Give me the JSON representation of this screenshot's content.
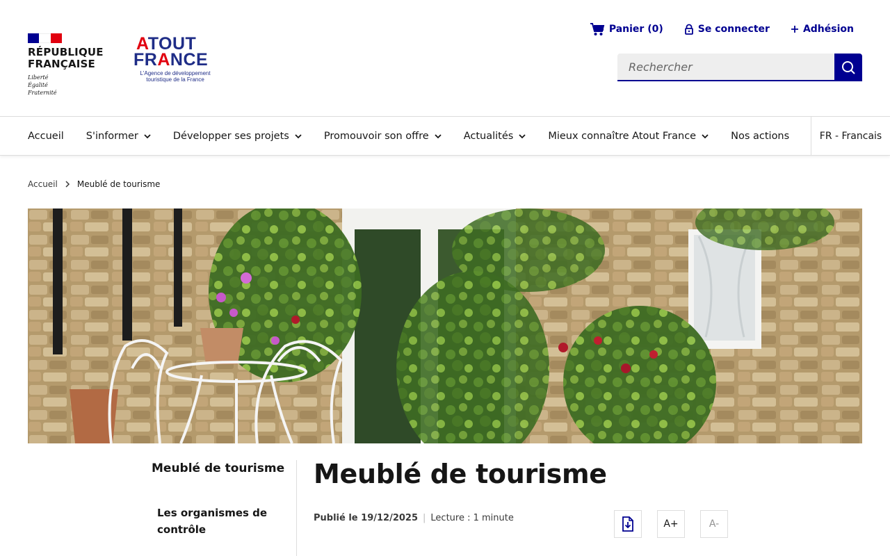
{
  "header": {
    "republique": {
      "title_line1": "RÉPUBLIQUE",
      "title_line2": "FRANÇAISE",
      "motto": [
        "Liberté",
        "Égalité",
        "Fraternité"
      ],
      "flag_colors": [
        "#000091",
        "#ffffff",
        "#e1000f"
      ]
    },
    "atout": {
      "line1_a": "A",
      "line1_rest": "TOUT",
      "line2_a": "FR",
      "line2_red": "A",
      "line2_rest": "NCE",
      "subtitle_line1": "L'Agence de développement",
      "subtitle_line2": "touristique de la France"
    },
    "tools": {
      "cart": "Panier (0)",
      "login": "Se connecter",
      "membership": "Adhésion"
    },
    "search": {
      "placeholder": "Rechercher"
    }
  },
  "nav": {
    "items": [
      {
        "label": "Accueil",
        "dropdown": false
      },
      {
        "label": "S'informer",
        "dropdown": true
      },
      {
        "label": "Développer ses projets",
        "dropdown": true
      },
      {
        "label": "Promouvoir son offre",
        "dropdown": true
      },
      {
        "label": "Actualités",
        "dropdown": true
      },
      {
        "label": "Mieux connaître Atout France",
        "dropdown": true
      },
      {
        "label": "Nos actions",
        "dropdown": false
      }
    ],
    "language": "FR - Francais"
  },
  "breadcrumb": {
    "home": "Accueil",
    "current": "Meublé de tourisme"
  },
  "side_menu": {
    "title": "Meublé de tourisme",
    "items": [
      "Les organismes de contrôle"
    ]
  },
  "article": {
    "title": "Meublé de tourisme",
    "published": "Publié le 19/12/2025",
    "reading": "Lecture : 1 minute",
    "font_increase": "A+",
    "font_decrease": "A-"
  },
  "colors": {
    "primary": "#000091",
    "accent_red": "#e1000f",
    "atout_blue": "#1f2d87"
  }
}
